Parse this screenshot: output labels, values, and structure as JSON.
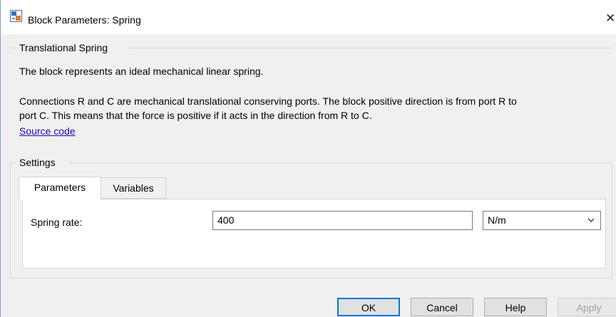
{
  "window": {
    "title": "Block Parameters: Spring",
    "close_glyph": "✕"
  },
  "block": {
    "group_title": "Translational Spring",
    "description_line1": "The block represents an ideal mechanical linear spring.",
    "description_line2": "Connections R and C are mechanical translational conserving ports. The block positive direction is from port R to",
    "description_line3": "port C. This means that the force is positive if it acts in the direction from R to C.",
    "source_link": "Source code"
  },
  "settings": {
    "group_title": "Settings",
    "tabs": [
      {
        "label": "Parameters",
        "active": true
      },
      {
        "label": "Variables",
        "active": false
      }
    ],
    "parameters": [
      {
        "label": "Spring rate:",
        "value": "400",
        "unit": "N/m"
      }
    ]
  },
  "buttons": {
    "ok": "OK",
    "cancel": "Cancel",
    "help": "Help",
    "apply": "Apply"
  },
  "icons": {
    "app": "simulink-block-icon",
    "close": "close-icon",
    "dropdown": "chevron-down-icon"
  },
  "colors": {
    "link": "#1a0dab",
    "ok_border": "#0078d7",
    "apply_disabled_text": "#a0a0a0"
  }
}
